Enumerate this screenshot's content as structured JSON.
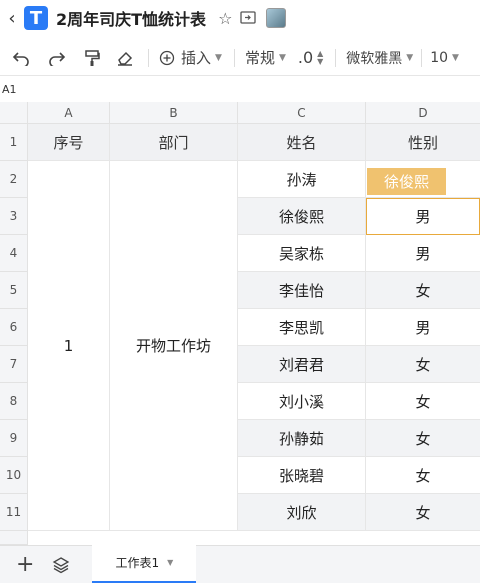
{
  "header": {
    "title": "2周年司庆T恤统计表",
    "logo_letter": "T"
  },
  "toolbar": {
    "insert_label": "插入",
    "format_label": "常规",
    "decimal_label": ".0",
    "font_label": "微软雅黑",
    "size_label": "10"
  },
  "cell_ref": "A1",
  "columns": [
    "A",
    "B",
    "C",
    "D"
  ],
  "rows": [
    "1",
    "2",
    "3",
    "4",
    "5",
    "6",
    "7",
    "8",
    "9",
    "10",
    "11"
  ],
  "table": {
    "headers": [
      "序号",
      "部门",
      "姓名",
      "性别"
    ],
    "merged_index": "1",
    "merged_dept": "开物工作坊",
    "names": [
      "孙涛",
      "徐俊熙",
      "吴家栋",
      "李佳怡",
      "李思凯",
      "刘君君",
      "刘小溪",
      "孙静茹",
      "张晓碧",
      "刘欣"
    ],
    "genders": [
      "",
      "男",
      "男",
      "女",
      "男",
      "女",
      "女",
      "女",
      "女",
      "女"
    ]
  },
  "tooltip_name": "徐俊熙",
  "sheet_tab": "工作表1",
  "colors": {
    "accent": "#2a7bf6",
    "selection": "#e8a93b",
    "tooltip_bg": "#f0c26f"
  }
}
